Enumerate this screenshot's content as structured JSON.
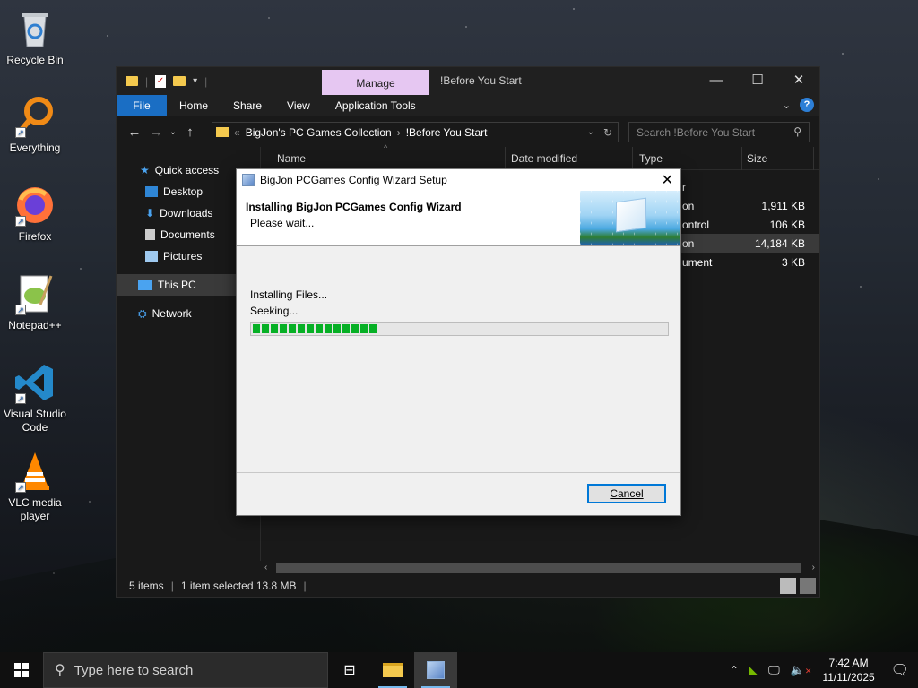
{
  "desktop": {
    "icons": [
      {
        "label": "Recycle Bin"
      },
      {
        "label": "Everything"
      },
      {
        "label": "Firefox"
      },
      {
        "label": "Notepad++"
      },
      {
        "label": "Visual Studio Code"
      },
      {
        "label": "VLC media player"
      }
    ]
  },
  "explorer": {
    "manage_tab": "Manage",
    "title": "!Before You Start",
    "ribbon_tabs": [
      "File",
      "Home",
      "Share",
      "View",
      "Application Tools"
    ],
    "breadcrumb": {
      "parent": "BigJon's PC Games Collection",
      "current": "!Before You Start"
    },
    "search_placeholder": "Search !Before You Start",
    "sidebar": [
      "Quick access",
      "Desktop",
      "Downloads",
      "Documents",
      "Pictures",
      "This PC",
      "Network"
    ],
    "columns": [
      "Name",
      "Date modified",
      "Type",
      "Size"
    ],
    "rows": [
      {
        "type": "r",
        "size": ""
      },
      {
        "type": "on",
        "size": "1,911 KB"
      },
      {
        "type": "ontrol",
        "size": "106 KB"
      },
      {
        "type": "on",
        "size": "14,184 KB"
      },
      {
        "type": "ument",
        "size": "3 KB"
      }
    ],
    "status": {
      "items": "5 items",
      "selected": "1 item selected  13.8 MB"
    }
  },
  "dialog": {
    "title": "BigJon PCGames Config Wizard Setup",
    "header_title": "Installing BigJon PCGames Config Wizard",
    "header_subtitle": "Please wait...",
    "line1": "Installing Files...",
    "line2": "Seeking...",
    "progress": 0.3,
    "cancel": "Cancel"
  },
  "taskbar": {
    "search_placeholder": "Type here to search",
    "time": "7:42 AM",
    "date": "11/11/2025"
  },
  "colors": {
    "accent": "#0078d7",
    "progress": "#06b025",
    "manage_tab": "#e6c7f2"
  }
}
